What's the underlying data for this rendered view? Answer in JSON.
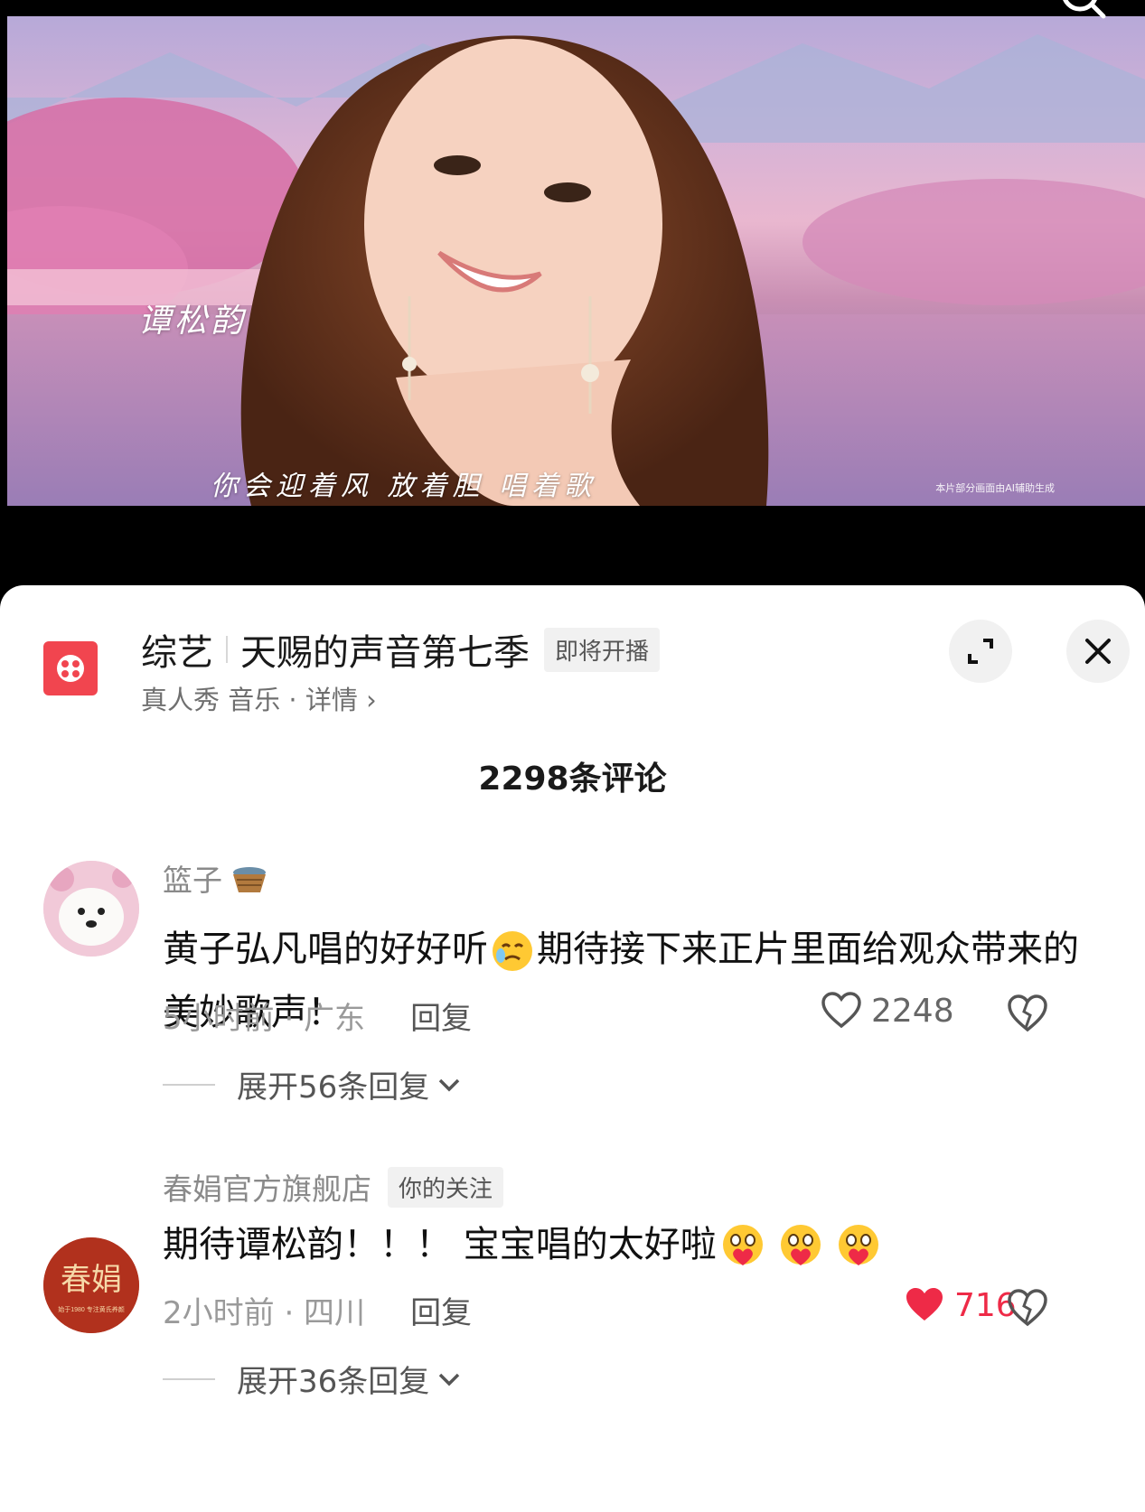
{
  "video": {
    "caption": "你会迎着风 放着胆 唱着歌",
    "name_overlay": "谭松韵",
    "ai_note": "本片部分画面由AI辅助生成"
  },
  "show": {
    "category": "综艺",
    "title": "天赐的声音第七季",
    "status_tag": "即将开播",
    "subtitle": "真人秀 音乐 · 详情 ›"
  },
  "comments_header": "2298条评论",
  "comments": [
    {
      "username": "篮子",
      "text_part1": "黄子弘凡唱的好好听",
      "text_part2": "期待接下来正片里面给观众带来的美妙歌声！",
      "meta": "5小时前 · 广东",
      "reply_label": "回复",
      "likes": "2248",
      "liked": false,
      "expand_label": "展开56条回复",
      "emoji": [
        "crying-face"
      ]
    },
    {
      "username": "春娟官方旗舰店",
      "badge": "你的关注",
      "avatar_text": "春娟",
      "avatar_subtext": "始于1980 专注黄氏养颜",
      "text": "期待谭松韵！！！ 宝宝唱的太好啦",
      "meta": "2小时前 · 四川",
      "reply_label": "回复",
      "likes": "716",
      "liked": true,
      "expand_label": "展开36条回复",
      "emoji": [
        "heart-hug-face",
        "heart-hug-face",
        "heart-hug-face"
      ]
    }
  ],
  "colors": {
    "like_active": "#ee2a47",
    "show_icon_bg": "#f1454f"
  }
}
